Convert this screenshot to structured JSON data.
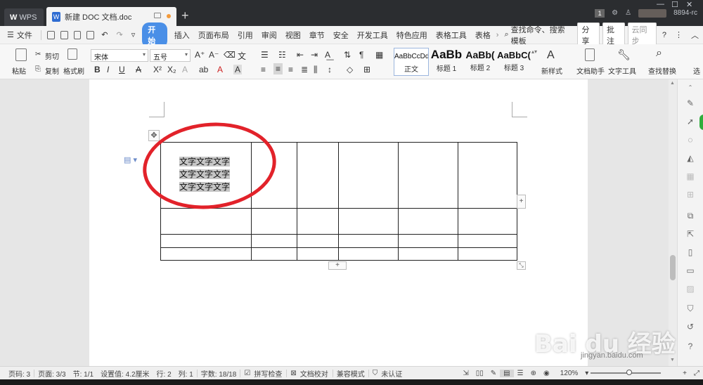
{
  "titlebar": {
    "wps_tab": "WPS",
    "doc_tab": "新建 DOC 文档.doc",
    "new_tab": "+",
    "badge": "1",
    "user_id": "8894-rc"
  },
  "menubar": {
    "file": "文件",
    "tabs": [
      "开始",
      "插入",
      "页面布局",
      "引用",
      "审阅",
      "视图",
      "章节",
      "安全",
      "开发工具",
      "特色应用",
      "表格工具",
      "表格"
    ],
    "search": "查找命令、搜索模板",
    "share": "分享",
    "annotate": "批注",
    "cloud_sync": "云同步"
  },
  "ribbon": {
    "paste": "粘贴",
    "cut": "剪切",
    "copy": "复制",
    "format_painter": "格式刷",
    "font_name": "宋体",
    "font_size": "五号",
    "styles": [
      {
        "preview": "AaBbCcDd",
        "label": "正文"
      },
      {
        "preview": "AaBb",
        "label": "标题 1"
      },
      {
        "preview": "AaBb(",
        "label": "标题 2"
      },
      {
        "preview": "AaBbC(",
        "label": "标题 3"
      }
    ],
    "new_style": "新样式",
    "doc_assistant": "文档助手",
    "text_tools": "文字工具",
    "find_replace": "查找替换",
    "select": "选"
  },
  "document": {
    "cell_lines": [
      "文字文字文字",
      "文字文字文字",
      "文字文字文字"
    ]
  },
  "statusbar": {
    "page_code": "页码: 3",
    "pages": "页面: 3/3",
    "section": "节: 1/1",
    "setting": "设置值: 4.2厘米",
    "row": "行: 2",
    "col": "列: 1",
    "word_count": "字数: 18/18",
    "spell_check": "拼写检查",
    "proofread": "文档校对",
    "compat": "兼容模式",
    "unverified": "未认证",
    "zoom": "120%"
  },
  "watermark": {
    "logo": "Bai du 经验",
    "url": "jingyan.baidu.com"
  },
  "colors": {
    "accent": "#4a8fe7",
    "annotation_red": "#e2222a",
    "titlebar_bg": "#2b2d30"
  }
}
